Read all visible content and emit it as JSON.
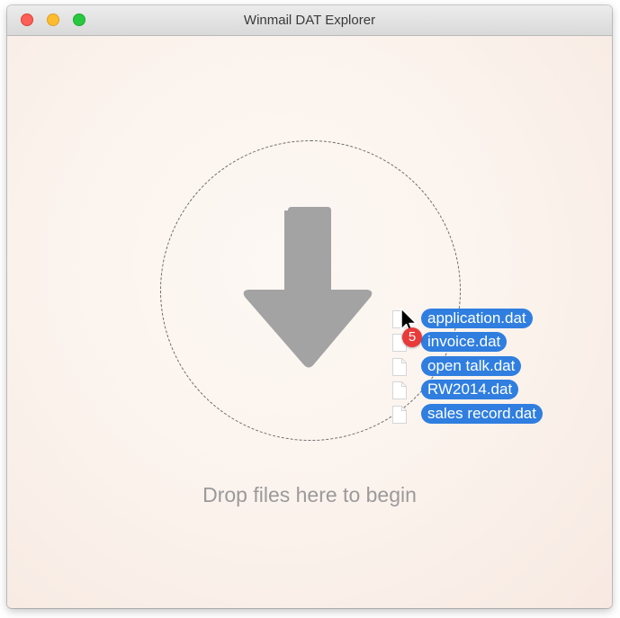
{
  "window": {
    "title": "Winmail DAT Explorer"
  },
  "drop_zone": {
    "hint": "Drop files here to begin",
    "icon": "download-arrow-icon"
  },
  "drag": {
    "count": "5",
    "files": [
      "application.dat",
      "invoice.dat",
      "open talk.dat",
      "RW2014.dat",
      "sales record.dat"
    ]
  },
  "colors": {
    "selection": "#2f7ee0",
    "badge": "#e93a3a",
    "arrow": "#a3a3a3"
  }
}
